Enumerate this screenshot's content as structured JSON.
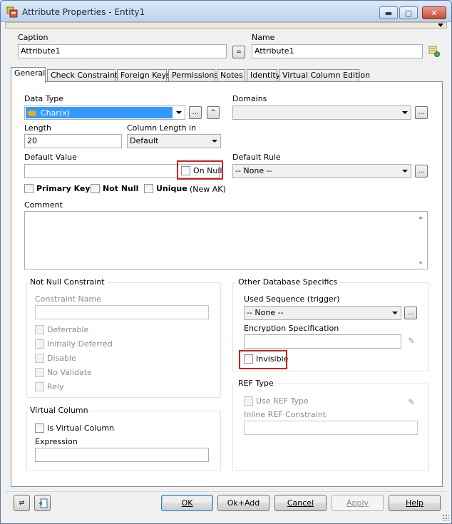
{
  "window": {
    "title": "Attribute Properties - Entity1",
    "min": "▬",
    "max": "▢",
    "close": "✕"
  },
  "header": {
    "caption_label": "Caption",
    "caption_value": "Attribute1",
    "equals_label": "=",
    "name_label": "Name",
    "name_value": "Attribute1"
  },
  "tabs": [
    "General",
    "Check Constraints",
    "Foreign Keys",
    "Permissions",
    "Notes",
    "Identity",
    "Virtual Column Edition"
  ],
  "general": {
    "data_type_label": "Data Type",
    "data_type_value": "Char(x)",
    "domains_label": "Domains",
    "domains_value": "",
    "length_label": "Length",
    "length_value": "20",
    "column_length_label": "Column Length in",
    "column_length_value": "Default",
    "default_value_label": "Default Value",
    "default_value": "",
    "on_null_label": "On Null",
    "default_rule_label": "Default Rule",
    "default_rule_value": "-- None --",
    "primary_key_label": "Primary Key",
    "not_null_label": "Not Null",
    "unique_label": "Unique",
    "new_ak_label": "(New AK)",
    "comment_label": "Comment",
    "ellipsis": "...",
    "caret": "^"
  },
  "not_null_constraint": {
    "title": "Not Null Constraint",
    "constraint_name_label": "Constraint Name",
    "deferrable_label": "Deferrable",
    "initially_deferred_label": "Initially Deferred",
    "disable_label": "Disable",
    "no_validate_label": "No Validate",
    "rely_label": "Rely"
  },
  "virtual_column": {
    "title": "Virtual Column",
    "is_virtual_label": "Is Virtual Column",
    "expression_label": "Expression"
  },
  "other_db": {
    "title": "Other Database Specifics",
    "used_sequence_label": "Used Sequence (trigger)",
    "used_sequence_value": "-- None --",
    "encryption_label": "Encryption Specification",
    "invisible_label": "Invisible"
  },
  "ref_type": {
    "title": "REF Type",
    "use_ref_type_label": "Use REF Type",
    "inline_ref_label": "Inline REF Constraint"
  },
  "buttons": {
    "ok": "OK",
    "ok_add": "Ok+Add",
    "cancel": "Cancel",
    "apply": "Apply",
    "help": "Help"
  },
  "icons": [
    "app-icon",
    "fields-icon",
    "swap-icon",
    "sync-icon"
  ],
  "colors": {
    "highlight": "#d21f1f",
    "selection": "#3399ff"
  }
}
